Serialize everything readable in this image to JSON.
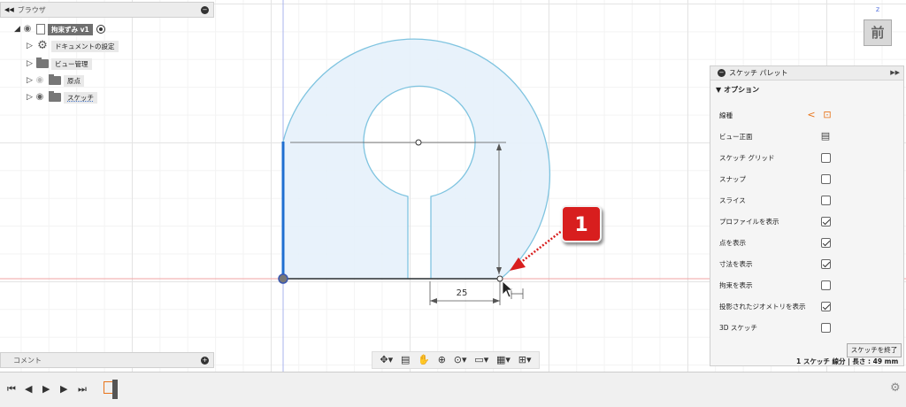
{
  "browser": {
    "title": "ブラウザ",
    "items": [
      {
        "label": "拘束ずみ v1",
        "icon": "document-icon"
      },
      {
        "label": "ドキュメントの設定",
        "icon": "gear-icon"
      },
      {
        "label": "ビュー管理",
        "icon": "folder-icon"
      },
      {
        "label": "原点",
        "icon": "folder-icon"
      },
      {
        "label": "スケッチ",
        "icon": "folder-icon"
      }
    ]
  },
  "comment_panel": {
    "title": "コメント"
  },
  "viewcube": {
    "face": "前",
    "axis": "Z"
  },
  "dimension": {
    "value": "25"
  },
  "callout": {
    "number": "1",
    "color": "#d81e1e"
  },
  "palette": {
    "title": "スケッチ パレット",
    "section": "オプション",
    "options": [
      {
        "label": "線種",
        "control": "icons"
      },
      {
        "label": "ビュー正面",
        "control": "icon"
      },
      {
        "label": "スケッチ グリッド",
        "control": "checkbox",
        "checked": false
      },
      {
        "label": "スナップ",
        "control": "checkbox",
        "checked": false
      },
      {
        "label": "スライス",
        "control": "checkbox",
        "checked": false
      },
      {
        "label": "プロファイルを表示",
        "control": "checkbox",
        "checked": true
      },
      {
        "label": "点を表示",
        "control": "checkbox",
        "checked": true
      },
      {
        "label": "寸法を表示",
        "control": "checkbox",
        "checked": true
      },
      {
        "label": "拘束を表示",
        "control": "checkbox",
        "checked": false
      },
      {
        "label": "投影されたジオメトリを表示",
        "control": "checkbox",
        "checked": true
      },
      {
        "label": "3D スケッチ",
        "control": "checkbox",
        "checked": false
      }
    ],
    "finish_button": "スケッチを終了",
    "status": "1 スケッチ 線分 | 長さ : 49 mm"
  },
  "colors": {
    "profile_fill": "#e6f1fb",
    "profile_stroke": "#7fc4e0",
    "axis_red": "#f2a3a3",
    "axis_blue": "#a9b3ee",
    "selected_line": "#1f6fd1",
    "accent": "#e8741a"
  }
}
